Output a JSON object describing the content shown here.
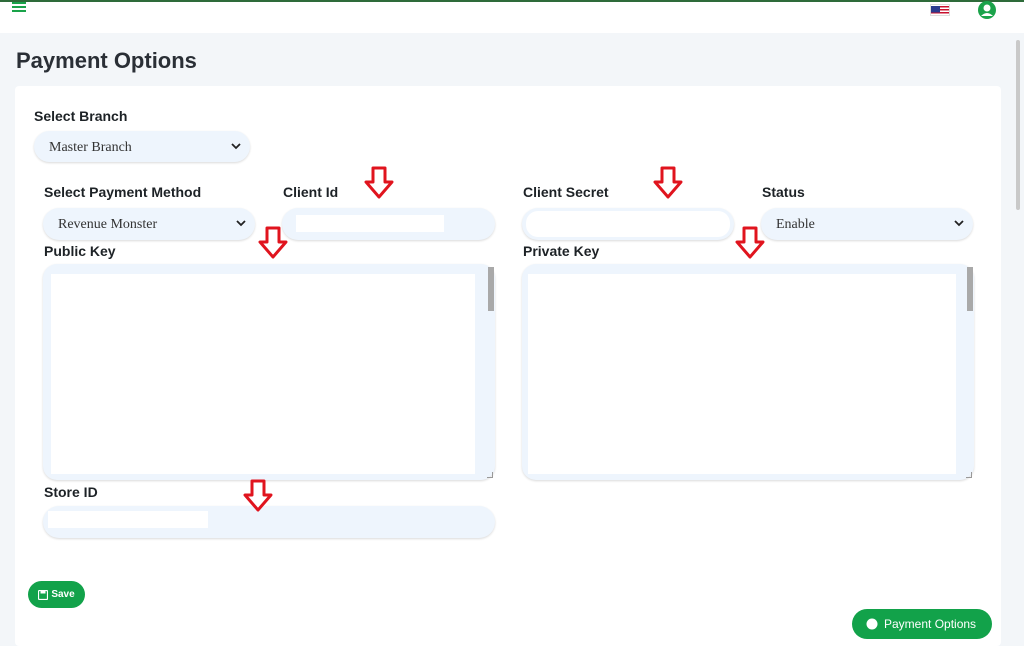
{
  "header": {
    "menu_icon": "hamburger-icon",
    "flag_icon": "us-flag-icon",
    "user_icon": "user-circle-icon"
  },
  "page": {
    "title": "Payment Options"
  },
  "form": {
    "branch_label": "Select Branch",
    "branch_value": "Master Branch",
    "method_label": "Select Payment Method",
    "method_value": "Revenue Monster",
    "client_id_label": "Client Id",
    "client_secret_label": "Client Secret",
    "status_label": "Status",
    "status_value": "Enable",
    "public_key_label": "Public Key",
    "private_key_label": "Private Key",
    "store_id_label": "Store ID"
  },
  "actions": {
    "save_label": "Save",
    "fab_label": "Payment Options"
  },
  "colors": {
    "accent": "#12a24a",
    "arrow": "#e0141e",
    "field_bg": "#eef5fd"
  }
}
